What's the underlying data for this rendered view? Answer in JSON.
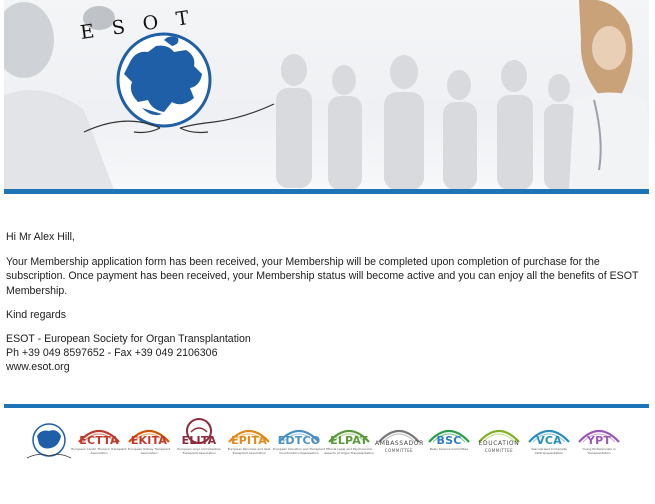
{
  "header": {
    "logo_text": "E S O T"
  },
  "email": {
    "greeting": "Hi Mr Alex Hill,",
    "paragraph": "Your Membership application form has been received, your Membership will be completed upon completion of purchase for the subscription. Once payment has been received, your Membership status will become active and you can enjoy all the benefits of ESOT Membership.",
    "closing": "Kind regards",
    "signature_org": "ESOT - European Society for Organ Transplantation",
    "signature_phone": "Ph +39 049 8597652 - Fax +39 049 2106306",
    "signature_web": "www.esot.org"
  },
  "footer": {
    "logos": [
      {
        "abbr": "",
        "sub": "",
        "color": "#1f73b7",
        "icon": "esot-globe-icon"
      },
      {
        "abbr": "ECTTA",
        "sub": "European Cardio Thoracic Transplant Association",
        "color": "#c0392b",
        "icon": "ectta-logo"
      },
      {
        "abbr": "EKITA",
        "sub": "European Kidney Transplant Association",
        "color": "#d35400",
        "icon": "ekita-logo"
      },
      {
        "abbr": "ELITA",
        "sub": "European Liver and Intestine Transplant Association",
        "color": "#8e2a3c",
        "icon": "elita-logo"
      },
      {
        "abbr": "EPITA",
        "sub": "European Pancreas and Islet Transplant Association",
        "color": "#e08a1e",
        "icon": "epita-logo"
      },
      {
        "abbr": "EDTCO",
        "sub": "European Donation and Transplant Coordination Organisation",
        "color": "#4a90c2",
        "icon": "edtco-logo"
      },
      {
        "abbr": "ELPAT",
        "sub": "Ethical Legal and Psychosocial Aspects of Organ Transplantation",
        "color": "#5a9a3a",
        "icon": "elpat-logo"
      },
      {
        "abbr": "AMBASSADOR",
        "sub": "COMMITTEE",
        "color": "#666666",
        "icon": "ambassador-committee-logo"
      },
      {
        "abbr": "BSC",
        "sub": "Basic Science Committee",
        "color": "#2e9c4a",
        "icon": "bsc-logo"
      },
      {
        "abbr": "EDUCATION",
        "sub": "COMMITTEE",
        "color": "#7fb227",
        "icon": "education-committee-logo"
      },
      {
        "abbr": "VCA",
        "sub": "Vascularised Composite Allotransplantation",
        "color": "#2a8fbd",
        "icon": "vca-logo"
      },
      {
        "abbr": "YPT",
        "sub": "Young Professionals in Transplantation",
        "color": "#9b59b6",
        "icon": "ypt-logo"
      }
    ]
  }
}
